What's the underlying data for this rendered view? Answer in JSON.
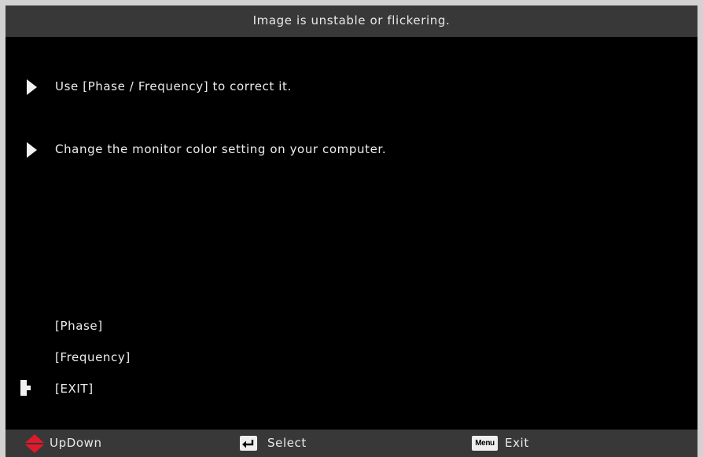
{
  "title": "Image is unstable or flickering.",
  "tips": [
    {
      "text": "Use [Phase / Frequency] to correct it.",
      "icon": "play-arrow-icon"
    },
    {
      "text": "Change the monitor color setting on your computer.",
      "icon": "play-arrow-icon"
    }
  ],
  "menu": {
    "items": [
      {
        "label": "[Phase]"
      },
      {
        "label": "[Frequency]"
      },
      {
        "label": "[EXIT]",
        "selected": true,
        "selected_icon": "exit-marker-icon"
      }
    ]
  },
  "status_bar": {
    "updown": {
      "label": "UpDown",
      "icon": "updown-arrows-icon",
      "color": "#e0192b"
    },
    "select": {
      "label": "Select",
      "icon": "enter-key-icon"
    },
    "exit": {
      "label": "Exit",
      "icon": "menu-key-icon",
      "key_text": "Menu"
    }
  },
  "colors": {
    "background": "#000000",
    "bars": "#383838",
    "frame": "#d2d2d2",
    "text": "#ededed"
  }
}
